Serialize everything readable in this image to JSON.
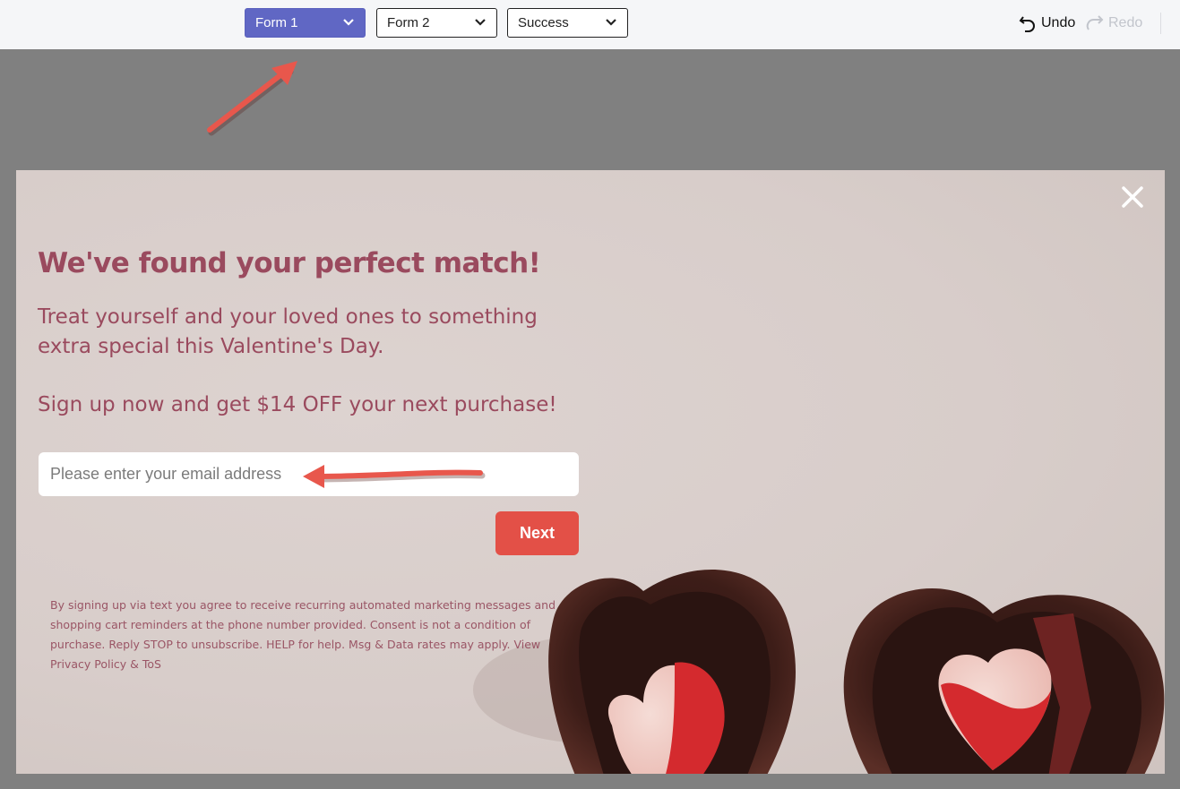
{
  "toolbar": {
    "forms": [
      {
        "label": "Form 1",
        "active": true
      },
      {
        "label": "Form 2",
        "active": false
      },
      {
        "label": "Success",
        "active": false
      }
    ],
    "undo_label": "Undo",
    "redo_label": "Redo"
  },
  "popup": {
    "headline": "We've found your perfect match!",
    "body": "Treat yourself and your loved ones to something extra special this Valentine's Day.",
    "offer": "Sign up now and get $14 OFF your next purchase!",
    "email_placeholder": "Please enter your email address",
    "next_label": "Next",
    "disclaimer": "By signing up via text you agree to receive recurring automated marketing messages and shopping cart reminders at the phone number provided. Consent is not a condition of purchase. Reply STOP to unsubscribe. HELP for help. Msg & Data rates may apply.",
    "privacy_link": "View Privacy Policy & ToS"
  },
  "colors": {
    "active_tab": "#6067c4",
    "headline": "#9a4a5e",
    "next_button": "#e35047",
    "annotation_arrow": "#e8574c"
  }
}
